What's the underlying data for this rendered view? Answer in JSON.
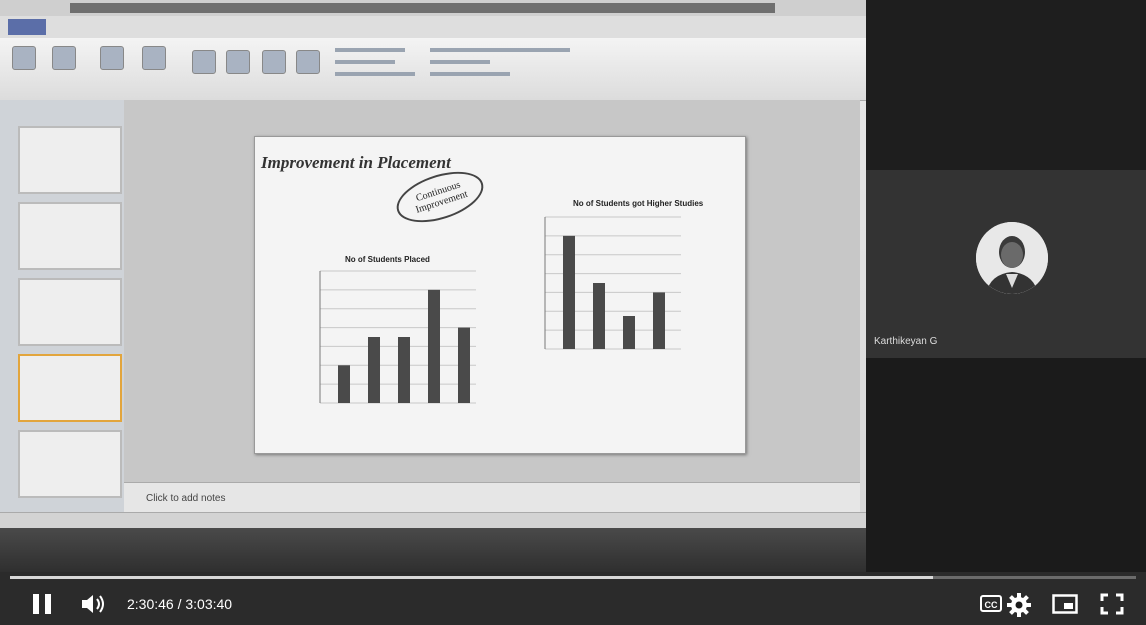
{
  "player": {
    "time_display": "2:30:46 / 3:03:40",
    "progress": 0.82,
    "cc_label": "CC"
  },
  "slide": {
    "title": "Improvement in Placement",
    "badge_text": "Continuous Improvement"
  },
  "notes_placeholder": "Click to add notes",
  "participant": {
    "name": "Karthikeyan G"
  },
  "chart_data": [
    {
      "type": "bar",
      "title": "No of Students Placed",
      "categories": [
        "",
        "",
        "",
        "",
        ""
      ],
      "values": [
        2,
        3.5,
        3.5,
        6,
        4
      ],
      "ylim": [
        0,
        7
      ]
    },
    {
      "type": "bar",
      "title": "No of Students got Higher Studies",
      "categories": [
        "",
        "",
        "",
        ""
      ],
      "values": [
        12,
        7,
        3.5,
        6
      ],
      "ylim": [
        0,
        14
      ]
    }
  ],
  "colors": {
    "progress_played": "#d8d8d8",
    "bar_fill": "#4a4a4a"
  }
}
